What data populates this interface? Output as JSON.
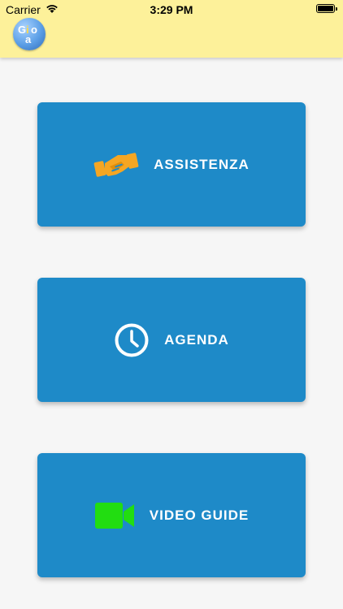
{
  "status_bar": {
    "carrier": "Carrier",
    "time": "3:29 PM",
    "icons": [
      "wifi-icon",
      "battery-icon"
    ]
  },
  "app_bar": {
    "background": "#fdf19a",
    "logo": {
      "letters": [
        "G",
        "i",
        "o",
        "a"
      ]
    }
  },
  "menu": {
    "card_color": "#1e8ac8",
    "items": [
      {
        "label": "ASSISTENZA",
        "icon": "handshake-icon",
        "icon_color": "#f5a623"
      },
      {
        "label": "AGENDA",
        "icon": "clock-icon",
        "icon_color": "#ffffff"
      },
      {
        "label": "VIDEO GUIDE",
        "icon": "video-camera-icon",
        "icon_color": "#22dd11"
      }
    ]
  }
}
